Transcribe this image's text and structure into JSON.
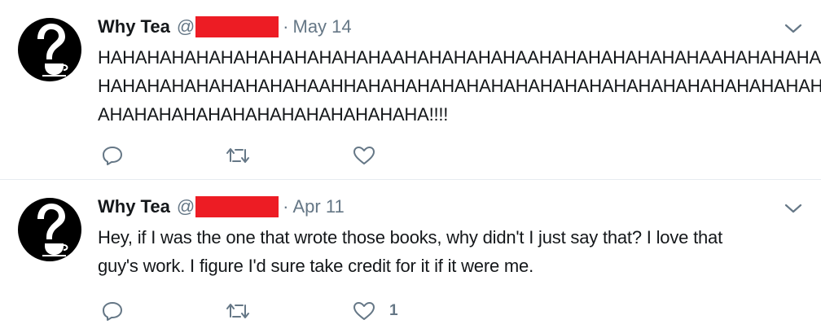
{
  "tweets": [
    {
      "name": "Why Tea",
      "handle_prefix": "@",
      "separator": "·",
      "date": "May 14",
      "text_lines": [
        "HAHAHAHAHAHAHAHAHAHAHAHAAHAHAHAHAHAAHAHAHAHAHAHAHAAHAHAHAHA",
        "HAHAHAHAHAHAHAHAHAAHHAHAHAHAHAHAHAHAHAHAHAHAHAHAHAHAHAHAHAH",
        "AHAHAHAHAHAHAHAHAHAHAHAHAHA!!!!"
      ],
      "reply_count": "",
      "retweet_count": "",
      "like_count": ""
    },
    {
      "name": "Why Tea",
      "handle_prefix": "@",
      "separator": "·",
      "date": "Apr 11",
      "text_lines": [
        "Hey, if I was the one that wrote those books, why didn't I just say that? I love that",
        "guy's work. I figure I'd sure take credit for it if it were me."
      ],
      "reply_count": "",
      "retweet_count": "",
      "like_count": "1"
    }
  ],
  "colors": {
    "text": "#14171a",
    "muted": "#657786",
    "redaction": "#ed1c24",
    "divider": "#e6ecf0"
  },
  "icons": {
    "avatar": "question-mark-teacup-avatar",
    "menu": "chevron-down-icon",
    "reply": "reply-icon",
    "retweet": "retweet-icon",
    "like": "heart-icon"
  }
}
